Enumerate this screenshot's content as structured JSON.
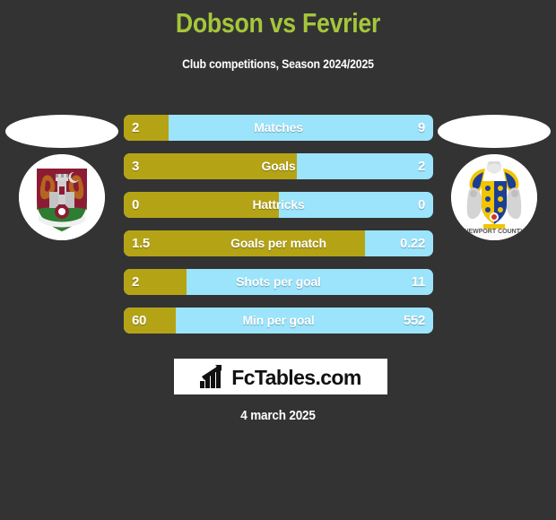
{
  "header": {
    "title": "Dobson vs Fevrier",
    "subtitle": "Club competitions, Season 2024/2025",
    "title_color": "#a5c63b"
  },
  "colors": {
    "background": "#333333",
    "home_bar": "#b5a316",
    "away_bar": "#9be4fb",
    "text": "#ffffff"
  },
  "home_player": {
    "photo_placeholder": "blank-player-photo",
    "crest_name": "northampton-town-crest"
  },
  "away_player": {
    "photo_placeholder": "blank-player-photo",
    "crest_name": "newport-county-crest",
    "crest_text": "NEWPORT COUNTY"
  },
  "chart_data": {
    "type": "bar",
    "title": "Dobson vs Fevrier",
    "subtitle": "Club competitions, Season 2024/2025",
    "orientation": "horizontal-split",
    "series": [
      {
        "name": "Dobson",
        "color": "#b5a316",
        "values": [
          2,
          3,
          0,
          1.5,
          2,
          60
        ]
      },
      {
        "name": "Fevrier",
        "color": "#9be4fb",
        "values": [
          9,
          2,
          0,
          0.22,
          11,
          552
        ]
      }
    ],
    "categories": [
      "Matches",
      "Goals",
      "Hattricks",
      "Goals per match",
      "Shots per goal",
      "Min per goal"
    ],
    "rows": [
      {
        "label": "Matches",
        "home": "2",
        "away": "9",
        "home_pct": 14.5
      },
      {
        "label": "Goals",
        "home": "3",
        "away": "2",
        "home_pct": 56.0
      },
      {
        "label": "Hattricks",
        "home": "0",
        "away": "0",
        "home_pct": 50.0
      },
      {
        "label": "Goals per match",
        "home": "1.5",
        "away": "0.22",
        "home_pct": 78.0
      },
      {
        "label": "Shots per goal",
        "home": "2",
        "away": "11",
        "home_pct": 20.3
      },
      {
        "label": "Min per goal",
        "home": "60",
        "away": "552",
        "home_pct": 16.8
      }
    ],
    "xlabel": "",
    "ylabel": "",
    "grid": false,
    "legend": "none"
  },
  "footer": {
    "logo_text": "FcTables.com",
    "logo_icon": "bar-chart-arrow-icon",
    "date": "4 march 2025"
  }
}
